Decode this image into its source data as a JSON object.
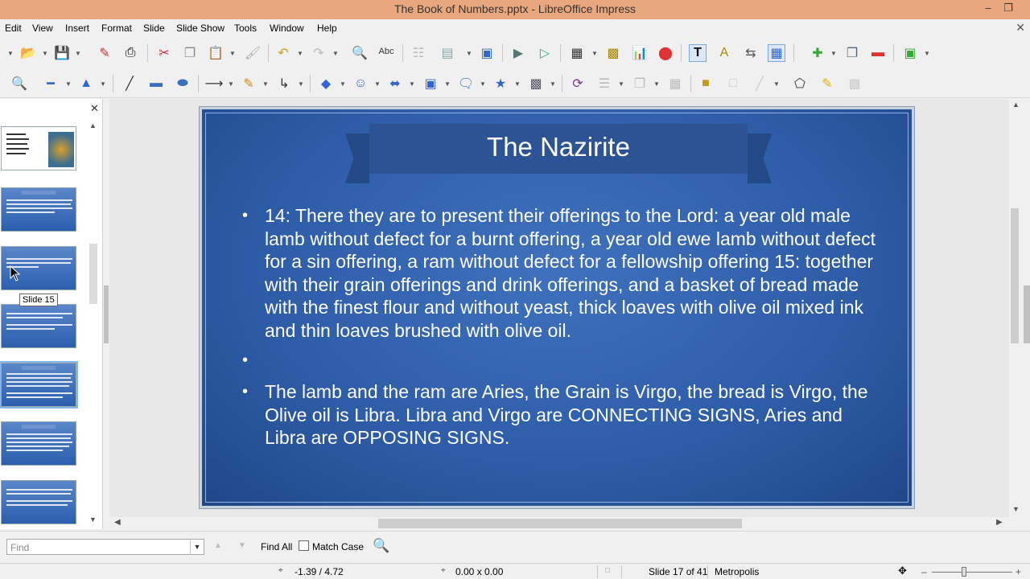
{
  "window": {
    "title": "The Book of Numbers.pptx - LibreOffice Impress"
  },
  "menu": [
    "Edit",
    "View",
    "Insert",
    "Format",
    "Slide",
    "Slide Show",
    "Tools",
    "Window",
    "Help"
  ],
  "slides_pane": {
    "tooltip": "Slide 15"
  },
  "slide": {
    "title": "The Nazirite",
    "bullets": [
      "14: There they are to present their offerings to the Lord: a year old male lamb without defect for a burnt offering, a year old ewe lamb without defect for a sin offering, a ram without defect for a fellowship offering 15: together with their grain offerings and drink offerings, and a basket of bread made with the finest flour and without yeast, thick loaves with olive oil mixed ink and thin loaves brushed with olive oil.",
      "",
      "The lamb and the ram are Aries, the Grain is Virgo, the bread is Virgo, the Olive oil is Libra. Libra and Virgo are CONNECTING SIGNS, Aries and Libra are OPPOSING SIGNS."
    ]
  },
  "findbar": {
    "placeholder": "Find",
    "find_all": "Find All",
    "match_case": "Match Case"
  },
  "status": {
    "position": "-1.39 / 4.72",
    "size": "0.00 x 0.00",
    "slide_info": "Slide 17 of 41",
    "master": "Metropolis"
  },
  "colors": {
    "titlebar": "#e9a77d",
    "slide_bg": "#2f5ea9"
  }
}
